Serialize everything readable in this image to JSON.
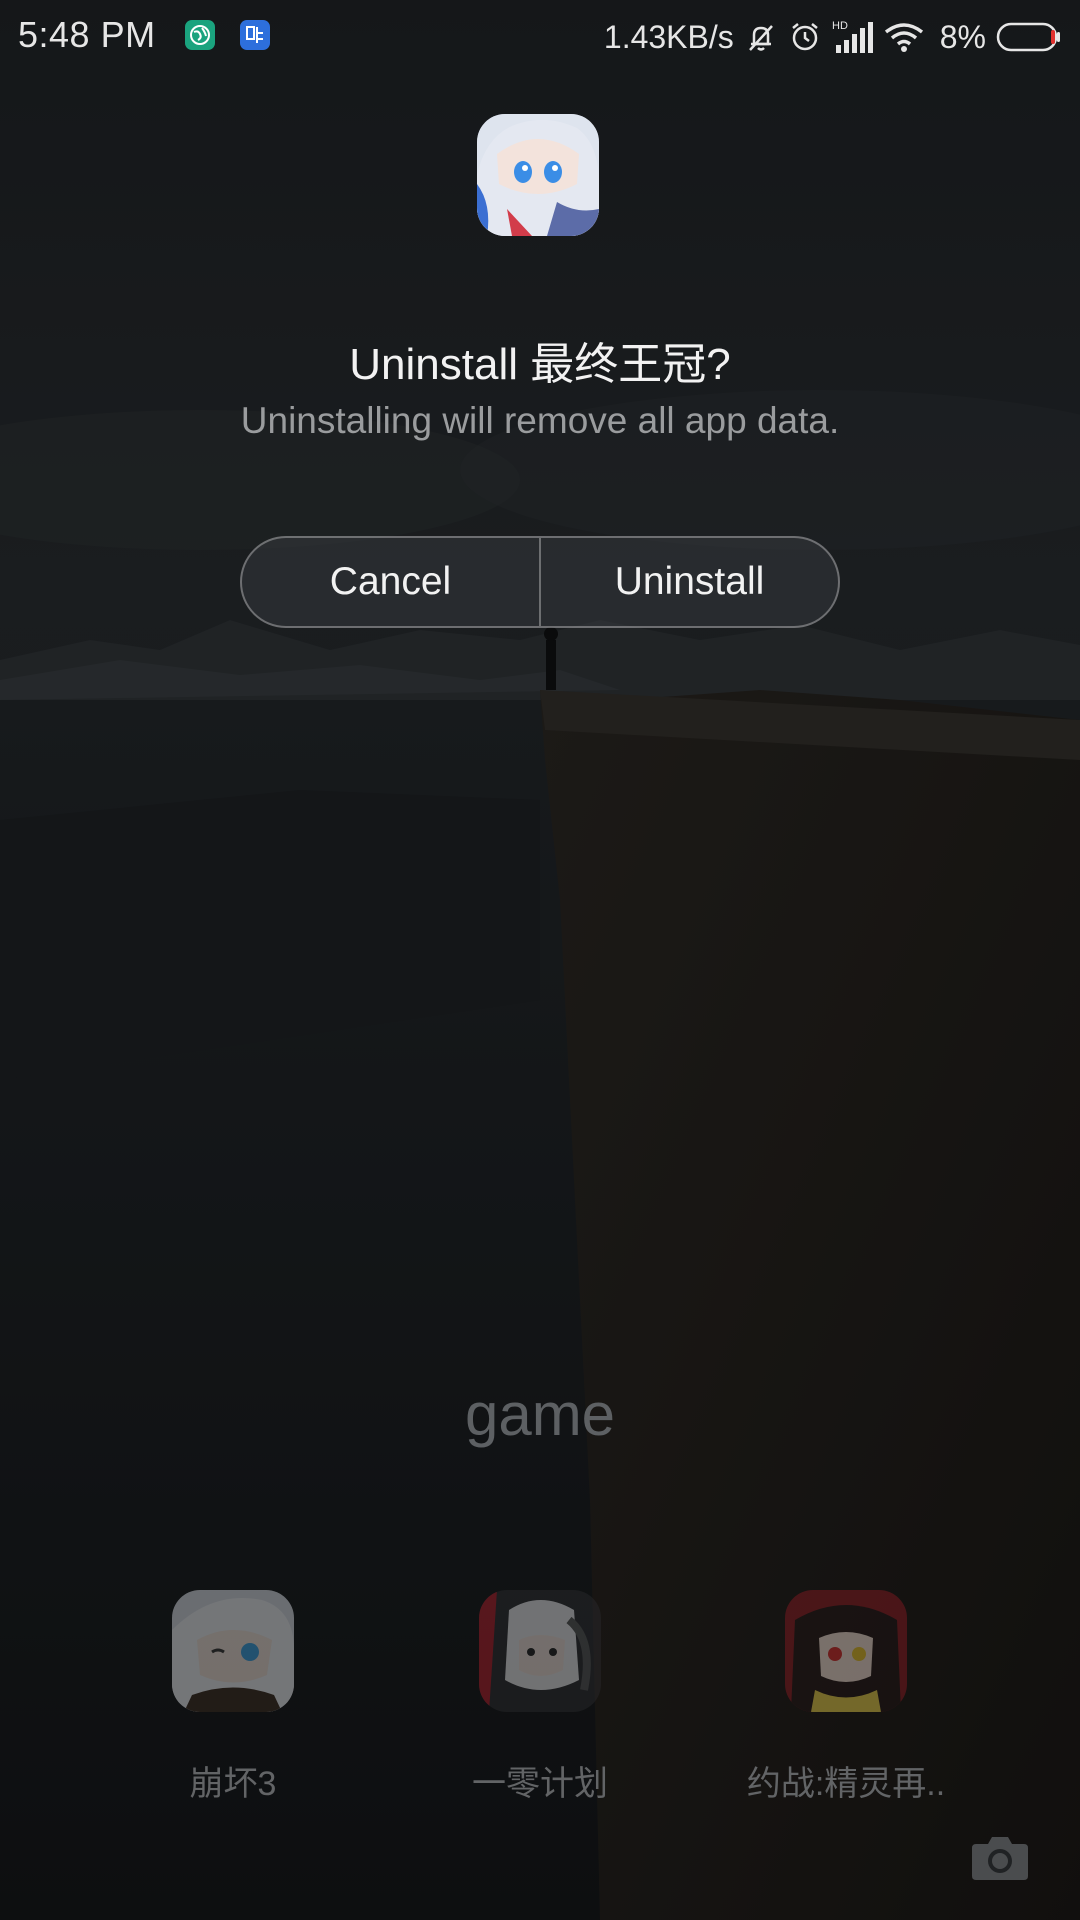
{
  "status_bar": {
    "time": "5:48 PM",
    "network_speed": "1.43KB/s",
    "signal_badge": "HD",
    "battery": "8%",
    "notification_icons": [
      "globe-icon",
      "tieba-icon"
    ],
    "system_icons": [
      "mute-bell-icon",
      "alarm-clock-icon",
      "cell-signal-icon",
      "wifi-icon",
      "battery-icon"
    ]
  },
  "dialog": {
    "title": "Uninstall 最终王冠?",
    "message": "Uninstalling will remove all app data.",
    "cancel_label": "Cancel",
    "uninstall_label": "Uninstall"
  },
  "folder": {
    "name": "game",
    "apps": [
      {
        "label": "崩坏3"
      },
      {
        "label": "一零计划"
      },
      {
        "label": "约战:精灵再.."
      }
    ]
  },
  "colors": {
    "accent_globe": "#1aa37e",
    "accent_tieba": "#2d6fdc",
    "battery_low": "#e0302d"
  }
}
